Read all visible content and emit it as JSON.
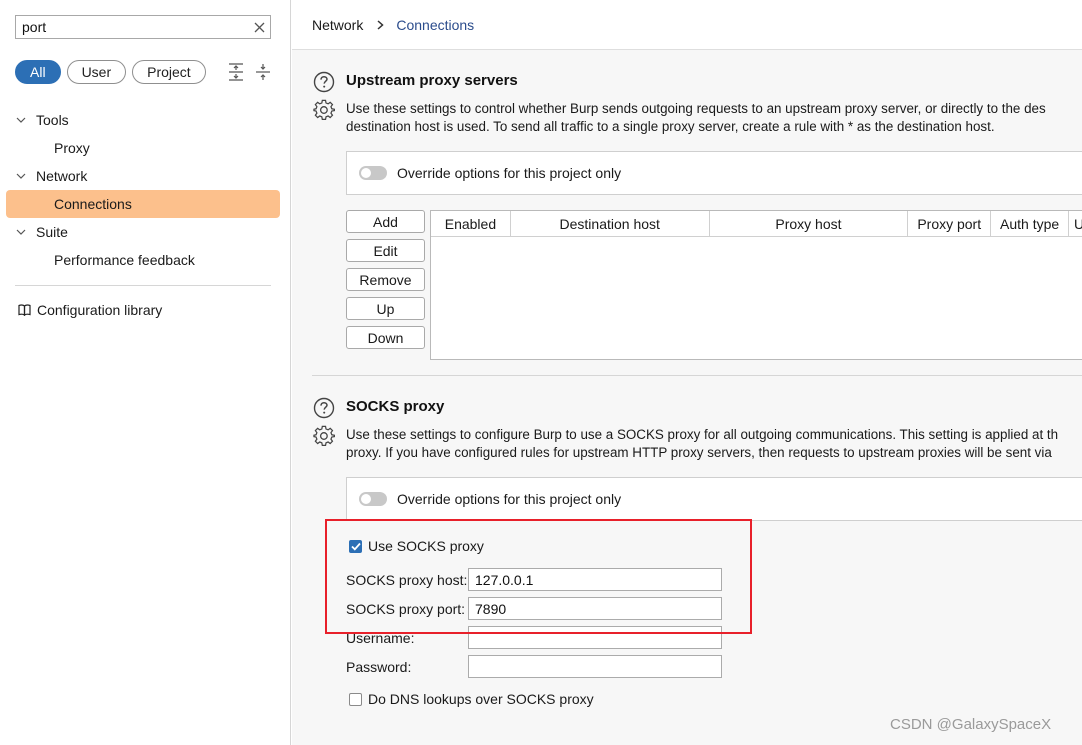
{
  "sidebar": {
    "search": {
      "value": "port",
      "clear_icon": "close-icon"
    },
    "filters": [
      "All",
      "User",
      "Project"
    ],
    "tree": [
      {
        "label": "Tools",
        "expanded": true,
        "children": [
          "Proxy"
        ]
      },
      {
        "label": "Network",
        "expanded": true,
        "children": [
          "Connections"
        ]
      },
      {
        "label": "Suite",
        "expanded": true,
        "children": [
          "Performance feedback"
        ]
      }
    ],
    "selected": "Connections",
    "config_library": "Configuration library",
    "selected_color": "#fcc08c"
  },
  "breadcrumb": {
    "parent": "Network",
    "current": "Connections"
  },
  "upstream": {
    "title": "Upstream proxy servers",
    "desc_line1": "Use these settings to  control whether Burp sends outgoing requests to an upstream proxy server, or directly to the des",
    "desc_line2": "destination host is used. To send all traffic to a single proxy server, create a rule with * as the destination host.",
    "override_label": "Override options for this project only",
    "buttons": [
      "Add",
      "Edit",
      "Remove",
      "Up",
      "Down"
    ],
    "columns": [
      "Enabled",
      "Destination host",
      "Proxy host",
      "Proxy port",
      "Auth type",
      "U"
    ]
  },
  "socks": {
    "title": "SOCKS proxy",
    "desc_line1": "Use these settings to configure Burp to use a SOCKS proxy for all outgoing communications. This setting is applied at th",
    "desc_line2": "proxy. If you have configured rules for upstream HTTP proxy servers, then requests to upstream proxies will be sent via",
    "override_label": "Override options for this project only",
    "use_socks_label": "Use SOCKS proxy",
    "use_socks_checked": true,
    "host_label": "SOCKS proxy host:",
    "host_value": "127.0.0.1",
    "port_label": "SOCKS proxy port:",
    "port_value": "7890",
    "username_label": "Username:",
    "username_value": "",
    "password_label": "Password:",
    "password_value": "",
    "dns_label": "Do DNS lookups over SOCKS proxy",
    "dns_checked": false
  },
  "watermark": "CSDN @GalaxySpaceX",
  "colors": {
    "accent": "#2c6fb5",
    "highlight": "#e8202a"
  }
}
